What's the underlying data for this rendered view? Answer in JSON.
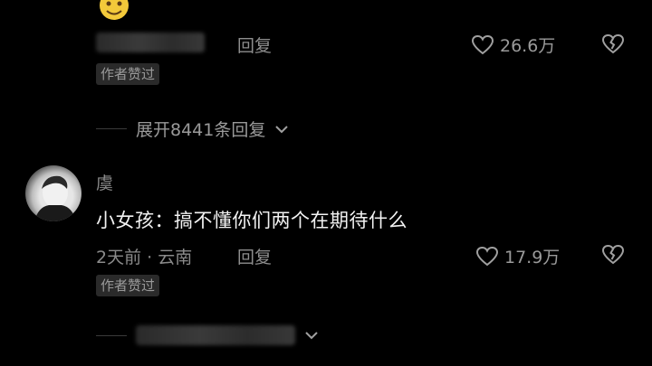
{
  "comment1": {
    "reply_label": "回复",
    "likes": "26.6万",
    "badge": "作者赞过"
  },
  "thread": {
    "expand_label": "展开8441条回复"
  },
  "comment2": {
    "author": "虞",
    "text": "小女孩：搞不懂你们两个在期待什么",
    "meta": "2天前 · 云南",
    "reply_label": "回复",
    "likes": "17.9万",
    "badge": "作者赞过"
  },
  "icons": {
    "like": "heart-outline-icon",
    "dislike": "broken-heart-icon",
    "expand": "chevron-down-icon",
    "emoji": "emoji-icon"
  }
}
